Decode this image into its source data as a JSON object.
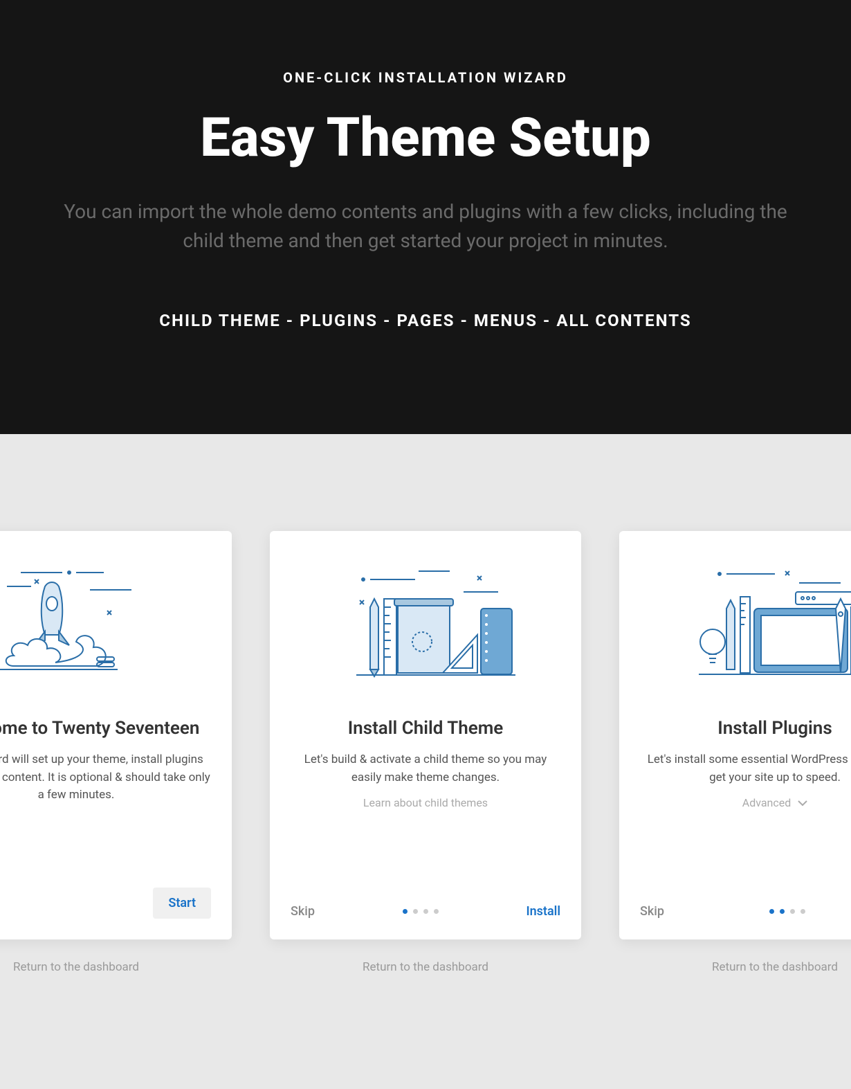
{
  "hero": {
    "eyebrow": "ONE-CLICK INSTALLATION WIZARD",
    "title": "Easy Theme Setup",
    "description": "You can import the whole demo contents and plugins with a few clicks, including the child theme and then get started your project in minutes.",
    "features": "CHILD THEME - PLUGINS - PAGES - MENUS - ALL CONTENTS"
  },
  "cards": [
    {
      "title": "Welcome to Twenty Seventeen",
      "description": "This wizard will set up your theme, install plugins and import content. It is optional & should take only a few minutes.",
      "sub": "",
      "skip": "",
      "action": "Start",
      "action_style": "button",
      "active_dots": [
        0
      ],
      "return": "Return to the dashboard"
    },
    {
      "title": "Install Child Theme",
      "description": "Let's build & activate a child theme so you may easily make theme changes.",
      "sub": "Learn about child themes",
      "skip": "Skip",
      "action": "Install",
      "action_style": "link",
      "active_dots": [
        0
      ],
      "return": "Return to the dashboard"
    },
    {
      "title": "Install Plugins",
      "description": "Let's install some essential WordPress plugins to get your site up to speed.",
      "sub": "Advanced",
      "sub_chevron": true,
      "skip": "Skip",
      "action": "",
      "action_style": "link",
      "active_dots": [
        0,
        1
      ],
      "return": "Return to the dashboard"
    }
  ]
}
